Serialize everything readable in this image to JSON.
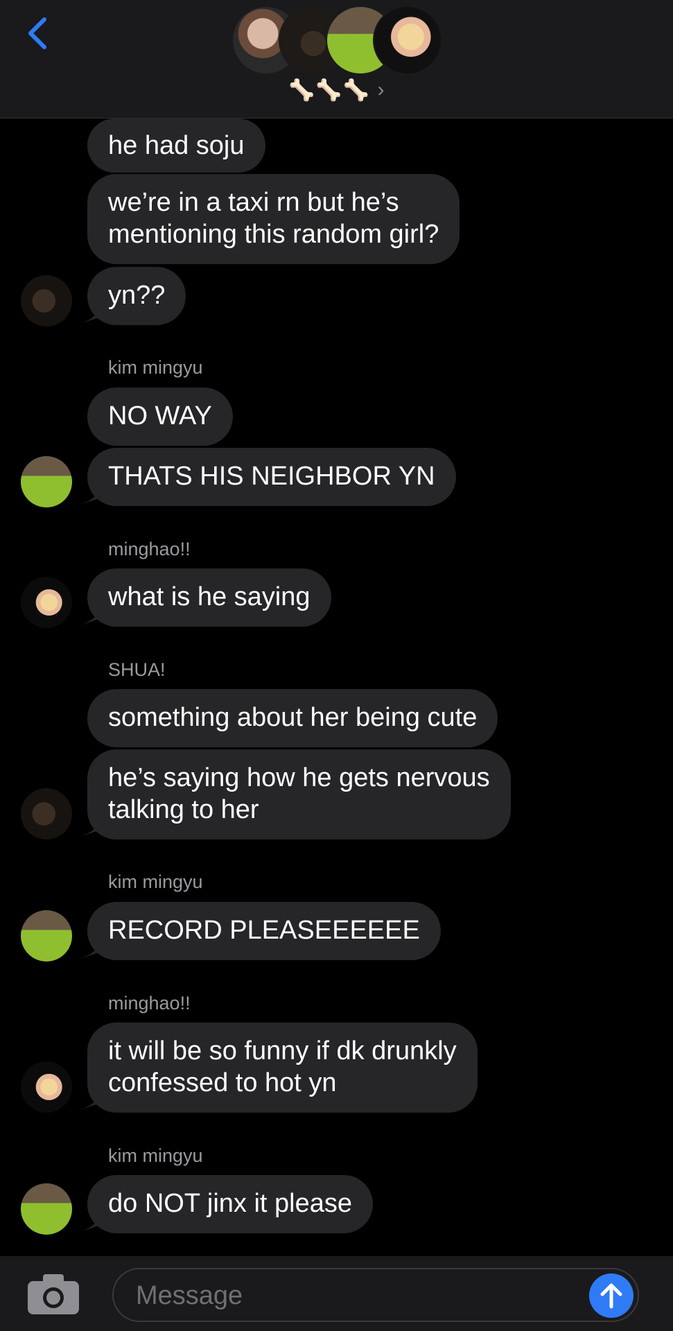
{
  "header": {
    "group_emoji": "🦴🦴🦴",
    "chevron": "›"
  },
  "messages": [
    {
      "text": "he had soju"
    },
    {
      "text_lines": [
        "we’re in a taxi rn but he’s",
        "mentioning this random girl?"
      ]
    },
    {
      "text": "yn??"
    },
    {
      "sender": "kim mingyu"
    },
    {
      "text": "NO WAY"
    },
    {
      "text": "THATS HIS NEIGHBOR YN"
    },
    {
      "sender": "minghao!!"
    },
    {
      "text": "what is he saying"
    },
    {
      "sender": "SHUA!"
    },
    {
      "text": "something about her being cute"
    },
    {
      "text_lines": [
        "he’s saying how he gets nervous",
        "talking to her"
      ]
    },
    {
      "sender": "kim mingyu"
    },
    {
      "text": "RECORD PLEASEEEEEE"
    },
    {
      "sender": "minghao!!"
    },
    {
      "text_lines": [
        "it will be so funny if dk drunkly",
        "confessed to hot yn"
      ]
    },
    {
      "sender": "kim mingyu"
    },
    {
      "text": "do NOT jinx it please"
    }
  ],
  "composer": {
    "placeholder": "Message"
  },
  "colors": {
    "accent": "#2f7bf6",
    "bubble": "#262629",
    "header_bg": "#1a1a1c"
  }
}
